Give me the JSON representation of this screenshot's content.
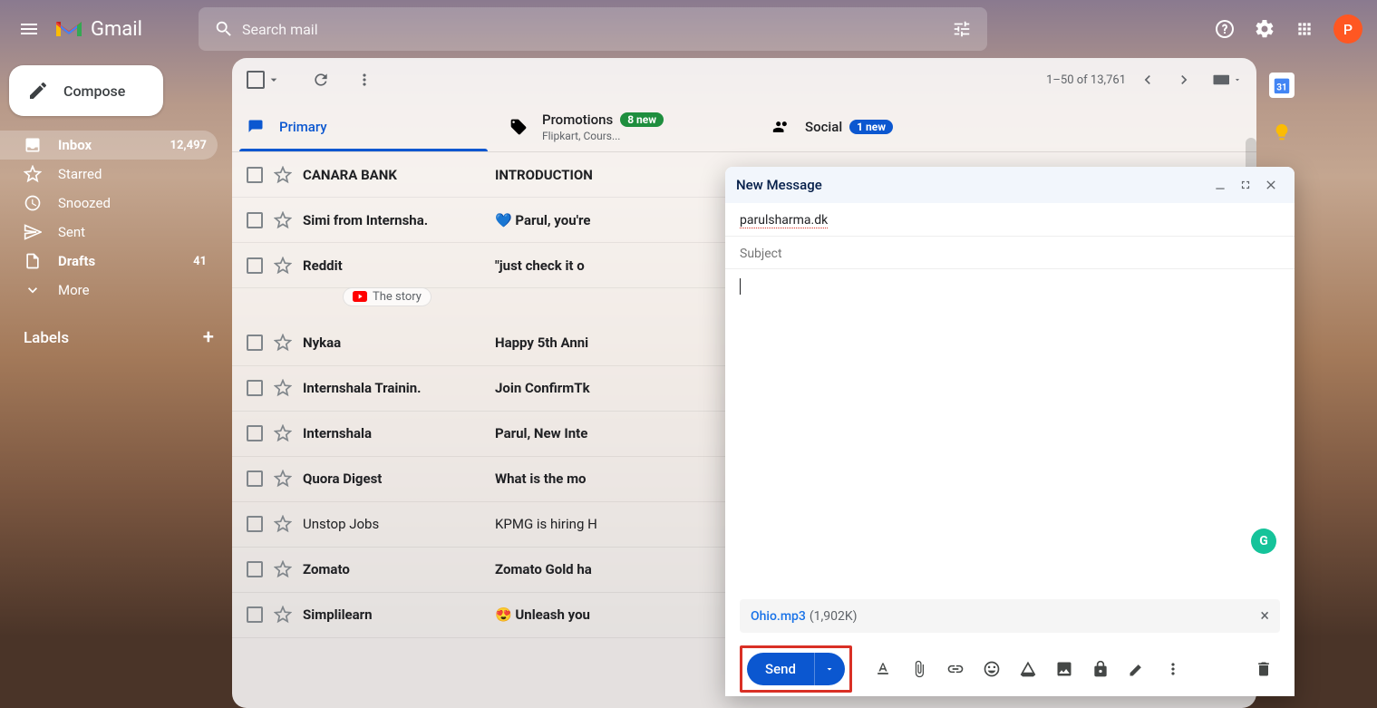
{
  "header": {
    "brand": "Gmail",
    "search_placeholder": "Search mail",
    "avatar_initial": "P"
  },
  "compose_label": "Compose",
  "sidebar": {
    "items": [
      {
        "label": "Inbox",
        "count": "12,497",
        "active": true,
        "bold": true,
        "icon": "inbox"
      },
      {
        "label": "Starred",
        "count": "",
        "active": false,
        "icon": "star"
      },
      {
        "label": "Snoozed",
        "count": "",
        "active": false,
        "icon": "clock"
      },
      {
        "label": "Sent",
        "count": "",
        "active": false,
        "icon": "send"
      },
      {
        "label": "Drafts",
        "count": "41",
        "active": false,
        "bold": true,
        "icon": "file"
      },
      {
        "label": "More",
        "count": "",
        "active": false,
        "icon": "expand"
      }
    ],
    "labels_header": "Labels"
  },
  "toolbar": {
    "pagination": "1–50 of 13,761"
  },
  "tabs": {
    "primary": "Primary",
    "promotions": "Promotions",
    "promotions_badge": "8 new",
    "promotions_sub": "Flipkart, Cours...",
    "social": "Social",
    "social_badge": "1 new"
  },
  "mails": [
    {
      "sender": "CANARA BANK",
      "subject": "INTRODUCTION",
      "bold": true
    },
    {
      "sender": "Simi from Internsha.",
      "subject": "💙 Parul, you're",
      "bold": true
    },
    {
      "sender": "Reddit",
      "subject": "\"just check it o",
      "bold": true,
      "chip": "The story"
    },
    {
      "sender": "Nykaa",
      "subject": "Happy 5th Anni",
      "bold": true
    },
    {
      "sender": "Internshala Trainin.",
      "subject": "Join ConfirmTk",
      "bold": true
    },
    {
      "sender": "Internshala",
      "subject": "Parul, New Inte",
      "bold": true
    },
    {
      "sender": "Quora Digest",
      "subject": "What is the mo",
      "bold": true
    },
    {
      "sender": "Unstop Jobs",
      "subject": "KPMG is hiring H",
      "bold": false
    },
    {
      "sender": "Zomato",
      "subject": "Zomato Gold ha",
      "bold": true
    },
    {
      "sender": "Simplilearn",
      "subject": "😍 Unleash you",
      "bold": true
    }
  ],
  "compose": {
    "title": "New Message",
    "to": "parulsharma.dk",
    "subject_placeholder": "Subject",
    "attachment_name": "Ohio.mp3",
    "attachment_size": "(1,902K)",
    "send_label": "Send"
  }
}
